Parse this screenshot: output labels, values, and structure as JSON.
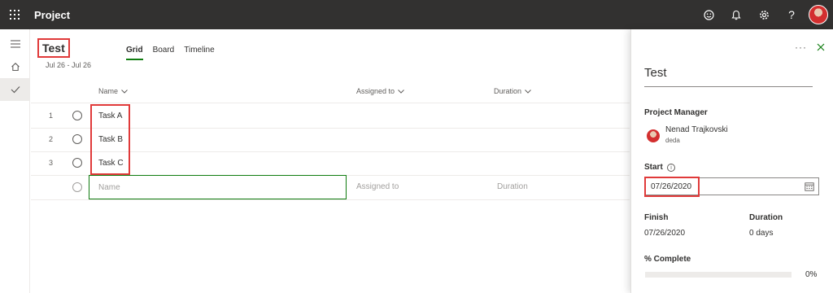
{
  "topbar": {
    "app_title": "Project",
    "help_label": "?"
  },
  "rail": {
    "items": [
      "menu",
      "home",
      "check"
    ]
  },
  "project": {
    "title": "Test",
    "dates": "Jul 26 - Jul 26"
  },
  "tabs": [
    "Grid",
    "Board",
    "Timeline"
  ],
  "grid": {
    "columns": {
      "name": "Name",
      "assigned": "Assigned to",
      "duration": "Duration"
    },
    "rows": [
      {
        "num": "1",
        "name": "Task A"
      },
      {
        "num": "2",
        "name": "Task B"
      },
      {
        "num": "3",
        "name": "Task C"
      }
    ],
    "new_row": {
      "name_placeholder": "Name",
      "assigned_placeholder": "Assigned to",
      "duration_placeholder": "Duration"
    }
  },
  "pane": {
    "title": "Test",
    "pm_label": "Project Manager",
    "pm_name": "Nenad Trajkovski",
    "pm_sub": "deda",
    "start_label": "Start",
    "start_value": "07/26/2020",
    "finish_label": "Finish",
    "finish_value": "07/26/2020",
    "duration_label": "Duration",
    "duration_value": "0 days",
    "complete_label": "% Complete",
    "complete_value": "0%"
  },
  "colors": {
    "accent": "#107c10",
    "highlight": "#e03a3a",
    "topbar": "#323130"
  }
}
